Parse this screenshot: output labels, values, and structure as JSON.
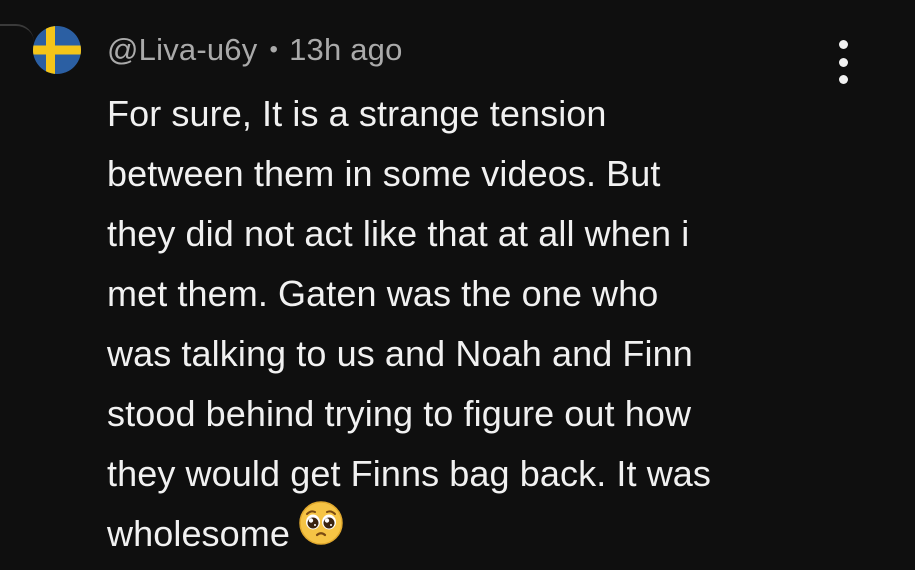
{
  "comment": {
    "author": "@Liva-u6y",
    "separator": "•",
    "timestamp": "13h ago",
    "avatar_icon": "sweden-flag-icon",
    "menu_icon": "more-vertical-icon",
    "lines": [
      "For sure, It is a strange tension",
      "between them in some videos. But",
      "they did not act like that at all when i",
      "met them. Gaten was the one who",
      "was talking to us and Noah and Finn",
      "stood behind trying to figure out how",
      "they would get Finns bag back. It was",
      "wholesome"
    ],
    "emoji_icon": "pleading-face-emoji-icon"
  },
  "colors": {
    "background": "#0f0f0f",
    "text_primary": "#f1f1f1",
    "text_secondary": "#aaaaaa",
    "flag_blue": "#2b5fa3",
    "flag_yellow": "#f5c518"
  }
}
